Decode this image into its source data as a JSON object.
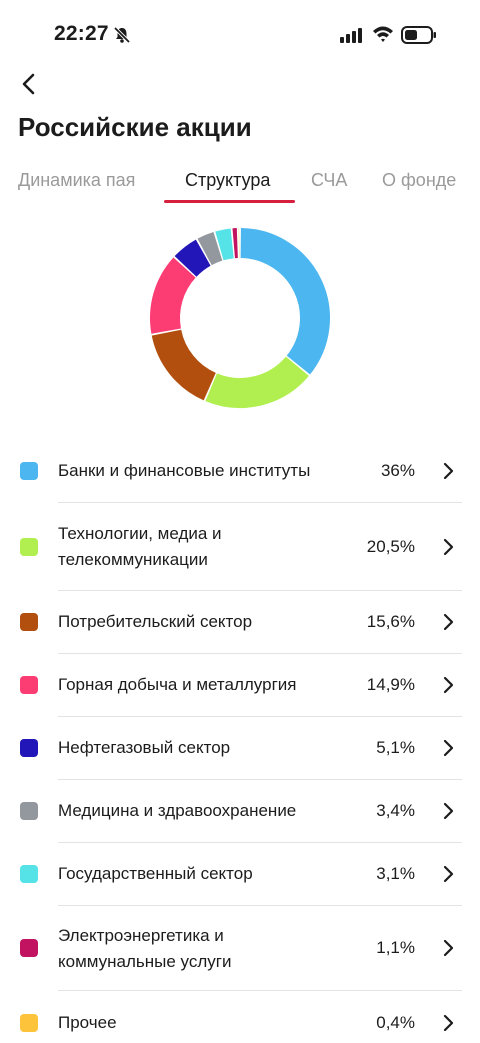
{
  "status_bar": {
    "time": "22:27"
  },
  "header": {
    "title": "Российские акции"
  },
  "tabs": [
    {
      "label": "Динамика пая",
      "active": false
    },
    {
      "label": "Структура",
      "active": true
    },
    {
      "label": "СЧА",
      "active": false
    },
    {
      "label": "О фонде",
      "active": false
    }
  ],
  "colors": {
    "accent": "#d61f3c"
  },
  "sectors": [
    {
      "label": "Банки и финансовые институты",
      "value_text": "36%",
      "value": 36,
      "color": "#4bb6ef"
    },
    {
      "label": "Технологии, медиа и телекоммуникации",
      "value_text": "20,5%",
      "value": 20.5,
      "color": "#b0ef4f"
    },
    {
      "label": "Потребительский сектор",
      "value_text": "15,6%",
      "value": 15.6,
      "color": "#b24f0e"
    },
    {
      "label": "Горная добыча и металлургия",
      "value_text": "14,9%",
      "value": 14.9,
      "color": "#fb3d74"
    },
    {
      "label": "Нефтегазовый сектор",
      "value_text": "5,1%",
      "value": 5.1,
      "color": "#2316b8"
    },
    {
      "label": "Медицина и здравоохранение",
      "value_text": "3,4%",
      "value": 3.4,
      "color": "#93979e"
    },
    {
      "label": "Государственный сектор",
      "value_text": "3,1%",
      "value": 3.1,
      "color": "#55e3e8"
    },
    {
      "label": "Электроэнергетика и коммунальные услуги",
      "value_text": "1,1%",
      "value": 1.1,
      "color": "#c1135f"
    },
    {
      "label": "Прочее",
      "value_text": "0,4%",
      "value": 0.4,
      "color": "#fdc33b"
    }
  ]
}
